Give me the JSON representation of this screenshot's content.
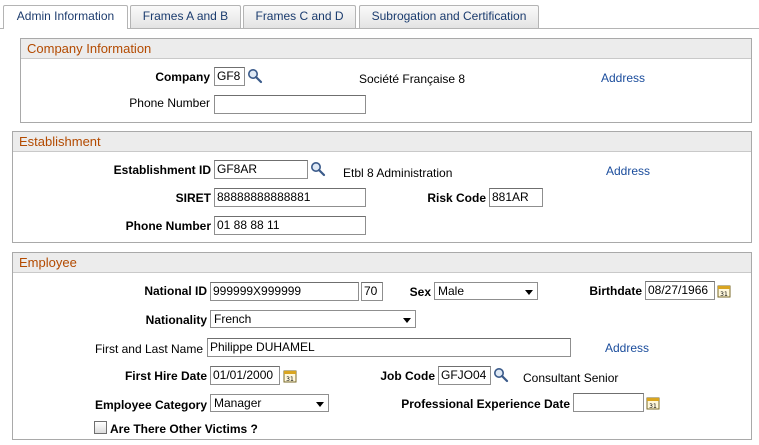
{
  "tabs": [
    {
      "label": "Admin Information",
      "active": true
    },
    {
      "label": "Frames A and B",
      "active": false
    },
    {
      "label": "Frames C and D",
      "active": false
    },
    {
      "label": "Subrogation and Certification",
      "active": false
    }
  ],
  "company": {
    "header": "Company Information",
    "company_label": "Company",
    "company_value": "GF8",
    "company_name": "Société Française 8",
    "address_link": "Address",
    "phone_label": "Phone Number",
    "phone_value": ""
  },
  "establishment": {
    "header": "Establishment",
    "id_label": "Establishment ID",
    "id_value": "GF8AR",
    "id_description": "Etbl 8 Administration",
    "address_link": "Address",
    "siret_label": "SIRET",
    "siret_value": "88888888888881",
    "risk_label": "Risk Code",
    "risk_value": "881AR",
    "phone_label": "Phone Number",
    "phone_value": "01 88 88 11"
  },
  "employee": {
    "header": "Employee",
    "national_id_label": "National ID",
    "national_id_value": "999999X999999",
    "national_id_key": "70",
    "sex_label": "Sex",
    "sex_value": "Male",
    "birthdate_label": "Birthdate",
    "birthdate_value": "08/27/1966",
    "nationality_label": "Nationality",
    "nationality_value": "French",
    "name_label": "First and Last Name",
    "name_value": "Philippe DUHAMEL",
    "address_link": "Address",
    "hire_label": "First Hire Date",
    "hire_value": "01/01/2000",
    "job_code_label": "Job Code",
    "job_code_value": "GFJO04",
    "job_description": "Consultant Senior",
    "category_label": "Employee Category",
    "category_value": "Manager",
    "experience_label": "Professional Experience Date",
    "experience_value": "",
    "victims_label": "Are There Other Victims ?",
    "victims_checked": false
  },
  "icons": {
    "lookup": "magnifier-icon",
    "calendar": "calendar-icon",
    "dropdown": "chevron-down-icon"
  }
}
